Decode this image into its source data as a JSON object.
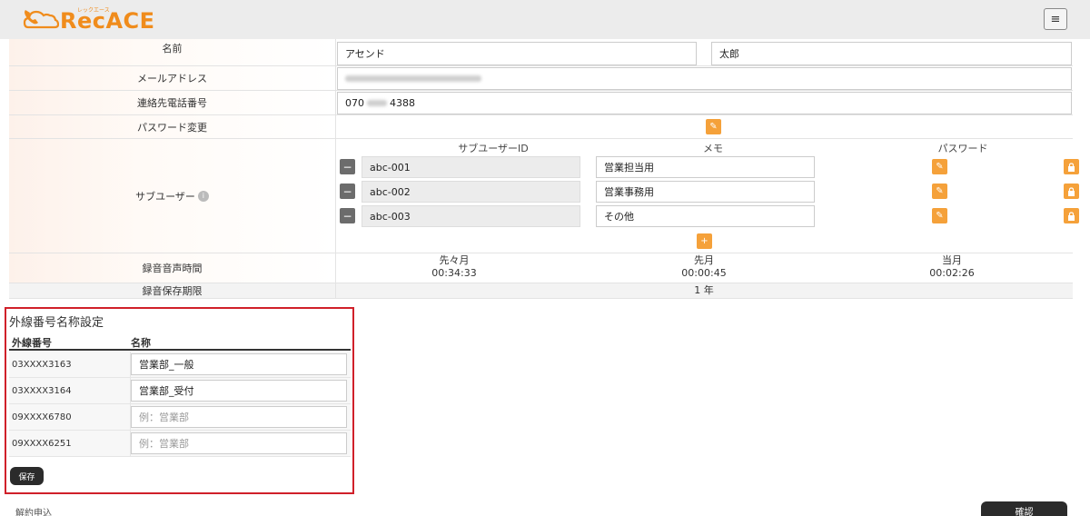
{
  "app": {
    "logo_text": "RecACE",
    "logo_kana": "レックエース",
    "menu_icon": "≡"
  },
  "profile": {
    "name_label": "名前",
    "last_name": "アセンド",
    "first_name": "太郎",
    "email_label": "メールアドレス",
    "phone_label": "連絡先電話番号",
    "phone_prefix": "070",
    "phone_suffix": "4388",
    "password_label": "パスワード変更",
    "sub_user_label": "サブユーザー",
    "sub_user_columns": {
      "id": "サブユーザーID",
      "memo": "メモ",
      "password": "パスワード"
    },
    "sub_users": [
      {
        "id": "abc-001",
        "memo": "営業担当用"
      },
      {
        "id": "abc-002",
        "memo": "営業事務用"
      },
      {
        "id": "abc-003",
        "memo": "その他"
      }
    ],
    "recording_time_label": "録音音声時間",
    "recording_periods": [
      {
        "label": "先々月",
        "value": "00:34:33"
      },
      {
        "label": "先月",
        "value": "00:00:45"
      },
      {
        "label": "当月",
        "value": "00:02:26"
      }
    ],
    "retention_label": "録音保存期限",
    "retention_value": "1 年"
  },
  "outside_lines": {
    "title": "外線番号名称設定",
    "col_number": "外線番号",
    "col_name": "名称",
    "rows": [
      {
        "number": "03XXXX3163",
        "name": "営業部_一般",
        "placeholder": ""
      },
      {
        "number": "03XXXX3164",
        "name": "営業部_受付",
        "placeholder": ""
      },
      {
        "number": "09XXXX6780",
        "name": "",
        "placeholder": "例：営業部"
      },
      {
        "number": "09XXXX6251",
        "name": "",
        "placeholder": "例：営業部"
      }
    ],
    "save_label": "保存"
  },
  "footer": {
    "cancel_label": "解約申込",
    "confirm_label": "確認"
  },
  "colors": {
    "accent": "#f5a13a",
    "brand": "#f08c1c",
    "highlight": "#d0202a",
    "dark_button": "#2b2b2b"
  }
}
